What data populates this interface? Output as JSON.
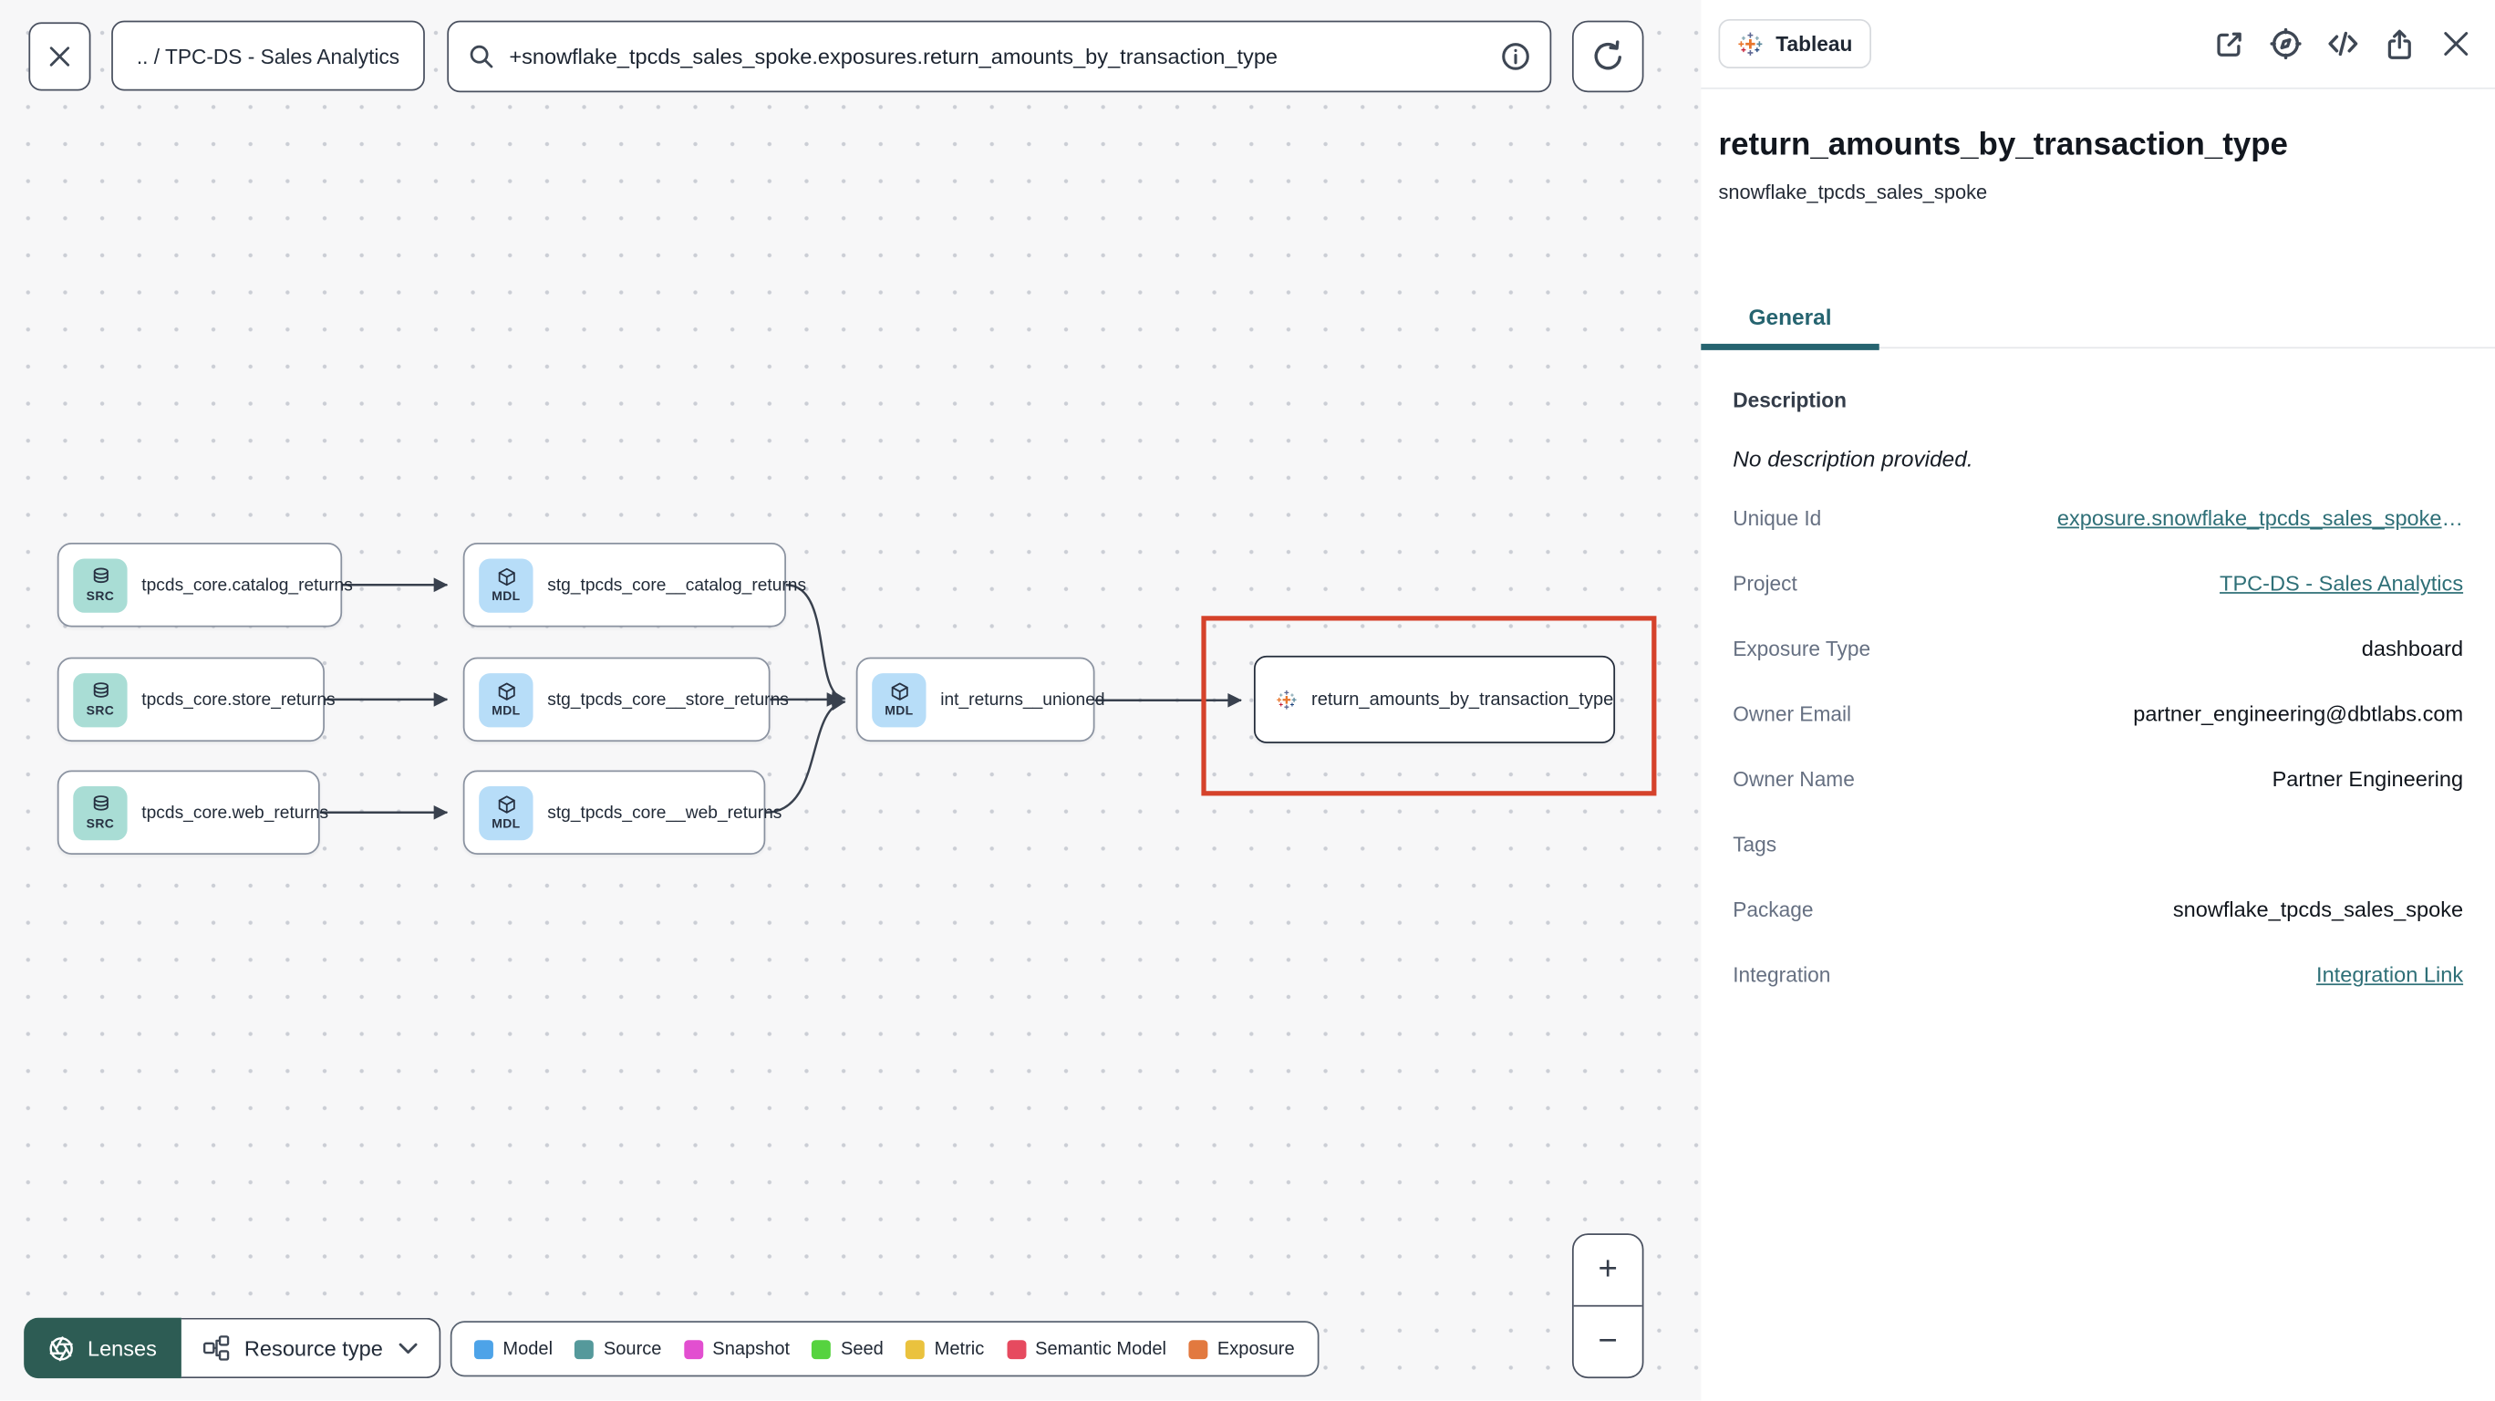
{
  "topbar": {
    "breadcrumb": ".. / TPC-DS - Sales Analytics",
    "search_value": "+snowflake_tpcds_sales_spoke.exposures.return_amounts_by_transaction_type"
  },
  "graph": {
    "nodes": [
      {
        "label": "tpcds_core.catalog_returns",
        "badge": "SRC",
        "type": "source"
      },
      {
        "label": "tpcds_core.store_returns",
        "badge": "SRC",
        "type": "source"
      },
      {
        "label": "tpcds_core.web_returns",
        "badge": "SRC",
        "type": "source"
      },
      {
        "label": "stg_tpcds_core__catalog_returns",
        "badge": "MDL",
        "type": "model"
      },
      {
        "label": "stg_tpcds_core__store_returns",
        "badge": "MDL",
        "type": "model"
      },
      {
        "label": "stg_tpcds_core__web_returns",
        "badge": "MDL",
        "type": "model"
      },
      {
        "label": "int_returns__unioned",
        "badge": "MDL",
        "type": "model"
      },
      {
        "label": "return_amounts_by_transaction_type",
        "type": "exposure"
      }
    ]
  },
  "controls": {
    "lenses_label": "Lenses",
    "resource_type_label": "Resource type",
    "zoom_in": "+",
    "zoom_out": "−"
  },
  "legend": {
    "items": [
      {
        "label": "Model",
        "color": "#4da3e8"
      },
      {
        "label": "Source",
        "color": "#55999b"
      },
      {
        "label": "Snapshot",
        "color": "#e24fd0"
      },
      {
        "label": "Seed",
        "color": "#56d33f"
      },
      {
        "label": "Metric",
        "color": "#eac23e"
      },
      {
        "label": "Semantic Model",
        "color": "#e64a5f"
      },
      {
        "label": "Exposure",
        "color": "#e2793f"
      }
    ]
  },
  "panel": {
    "badge_label": "Tableau",
    "title": "return_amounts_by_transaction_type",
    "subtitle": "snowflake_tpcds_sales_spoke",
    "tabs": [
      {
        "label": "General"
      }
    ],
    "description_header": "Description",
    "description_empty": "No description provided.",
    "fields": [
      {
        "label": "Unique Id",
        "value": "exposure.snowflake_tpcds_sales_spoke",
        "suffix": "…",
        "link": true
      },
      {
        "label": "Project",
        "value": "TPC-DS - Sales Analytics",
        "link": true
      },
      {
        "label": "Exposure Type",
        "value": "dashboard"
      },
      {
        "label": "Owner Email",
        "value": "partner_engineering@dbtlabs.com"
      },
      {
        "label": "Owner Name",
        "value": "Partner Engineering"
      },
      {
        "label": "Tags",
        "value": ""
      },
      {
        "label": "Package",
        "value": "snowflake_tpcds_sales_spoke"
      },
      {
        "label": "Integration",
        "value": "Integration Link",
        "link": true
      }
    ]
  },
  "colors": {
    "accent_teal": "#266470",
    "link_teal": "#2e6f77",
    "highlight_red": "#d5422b",
    "lenses_green": "#2d5c54"
  }
}
